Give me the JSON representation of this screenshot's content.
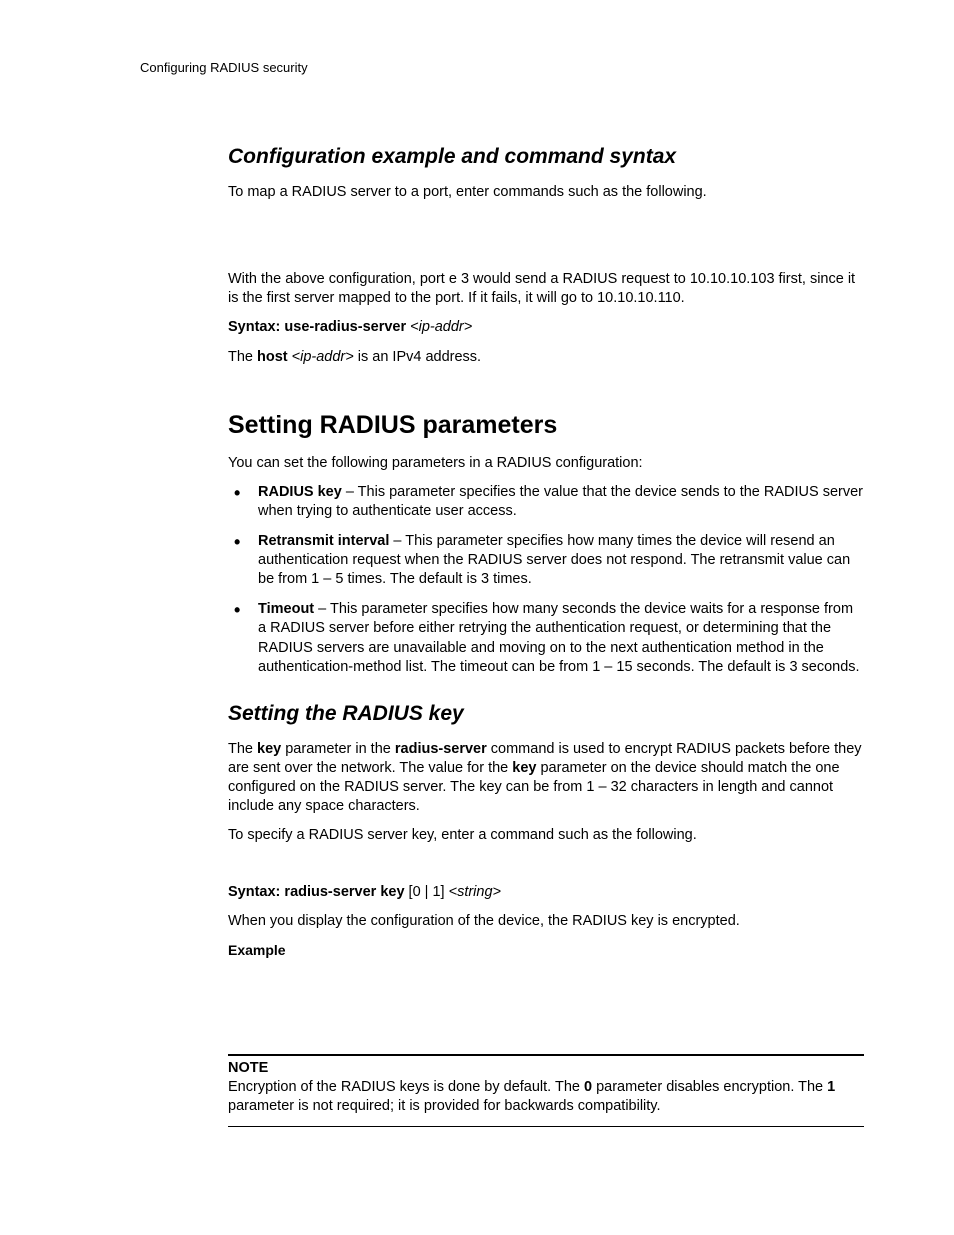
{
  "running_head": "Configuring RADIUS security",
  "h1": "Configuration example and command syntax",
  "p1": "To map a RADIUS server to a port, enter commands such as the following.",
  "p2": "With the above configuration, port e 3 would send a RADIUS request to 10.10.10.103 first, since it is the first server mapped to the port. If it fails, it will go to 10.10.10.110.",
  "syn1_label": "Syntax:",
  "syn1_cmd": "use-radius-server",
  "syn1_arg": "<ip-addr>",
  "p3a": "The ",
  "p3b": "host",
  "p3c": " <ip-addr>",
  "p3d": " is an IPv4 address.",
  "h2": "Setting RADIUS parameters",
  "p4": "You can set the following parameters in a RADIUS configuration:",
  "bullets": [
    {
      "lead": "RADIUS key",
      "rest": " – This parameter specifies the value that the device sends to the RADIUS server when trying to authenticate user access."
    },
    {
      "lead": "Retransmit interval",
      "rest": " – This parameter specifies how many times the device will resend an authentication request when the RADIUS server does not respond. The retransmit value can be from 1 – 5 times. The default is 3 times."
    },
    {
      "lead": "Timeout",
      "rest": " – This parameter specifies how many seconds the device waits for a response from a RADIUS server before either retrying the authentication request, or determining that the RADIUS servers are unavailable and moving on to the next authentication method in the authentication-method list. The timeout can be from 1 – 15 seconds. The default is 3 seconds."
    }
  ],
  "h3": "Setting the RADIUS key",
  "p5a": "The ",
  "p5b": "key",
  "p5c": " parameter in the ",
  "p5d": "radius-server",
  "p5e": " command is used to encrypt RADIUS packets before they are sent over the network. The value for the ",
  "p5f": "key",
  "p5g": " parameter on the device should match the one configured on the RADIUS server. The key can be from 1 – 32 characters in length and cannot include any space characters.",
  "p6": "To specify a RADIUS server key, enter a command such as the following.",
  "syn2_label": "Syntax:",
  "syn2_cmd": "radius-server key",
  "syn2_br": " [0 | 1]  ",
  "syn2_arg": "<string>",
  "p7": "When you display the configuration of the device, the RADIUS key is encrypted.",
  "example_label": "Example",
  "note_label": "NOTE",
  "note_a": "Encryption of the RADIUS keys is done by default. The ",
  "note_b": "0",
  "note_c": " parameter disables encryption. The ",
  "note_d": "1",
  "note_e": " parameter is not required; it is provided for backwards compatibility."
}
